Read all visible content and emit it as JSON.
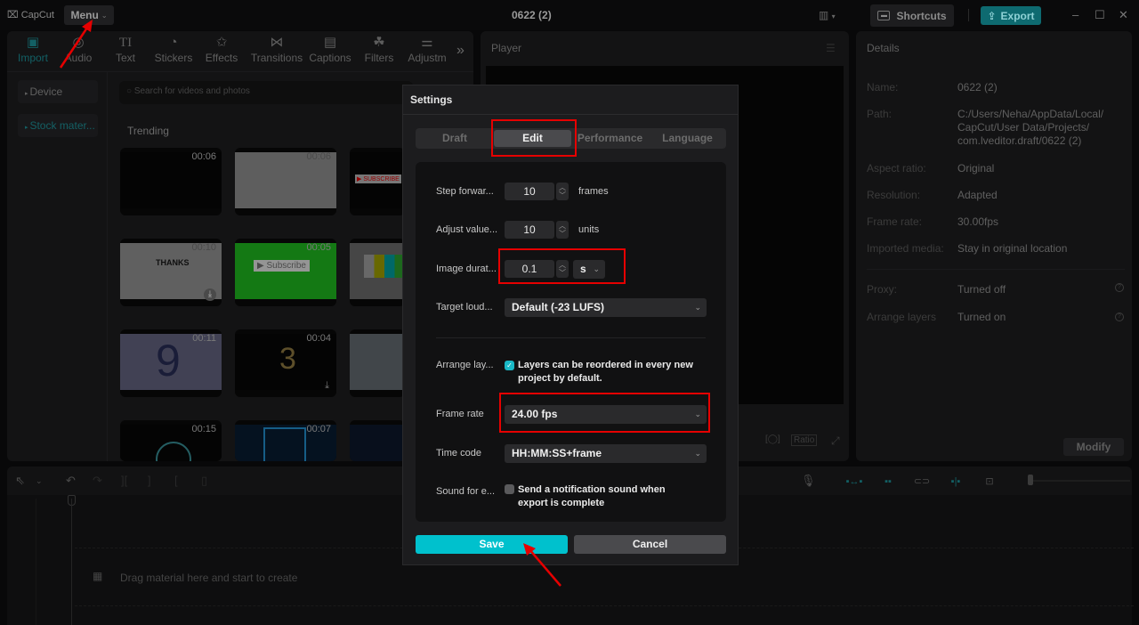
{
  "titlebar": {
    "app_name": "CapCut",
    "menu_label": "Menu",
    "project_title": "0622 (2)",
    "shortcuts_label": "Shortcuts",
    "export_label": "Export"
  },
  "toolbar": {
    "tabs": [
      {
        "label": "Import",
        "icon": "import-icon",
        "glyph": "▣",
        "active": true
      },
      {
        "label": "Audio",
        "icon": "audio-icon",
        "glyph": "◎",
        "active": false
      },
      {
        "label": "Text",
        "icon": "text-icon",
        "glyph": "TI",
        "active": false
      },
      {
        "label": "Stickers",
        "icon": "stickers-icon",
        "glyph": "◔",
        "active": false
      },
      {
        "label": "Effects",
        "icon": "effects-icon",
        "glyph": "✩",
        "active": false
      },
      {
        "label": "Transitions",
        "icon": "transitions-icon",
        "glyph": "⋈",
        "active": false
      },
      {
        "label": "Captions",
        "icon": "captions-icon",
        "glyph": "▤",
        "active": false
      },
      {
        "label": "Filters",
        "icon": "filters-icon",
        "glyph": "☘",
        "active": false
      },
      {
        "label": "Adjustm",
        "icon": "adjustment-icon",
        "glyph": "⚌",
        "active": false
      }
    ],
    "more_glyph": "»"
  },
  "media": {
    "nav": [
      {
        "label": "Device",
        "active": false
      },
      {
        "label": "Stock mater...",
        "active": true
      }
    ],
    "search_placeholder": "Search for videos and photos",
    "section_title": "Trending",
    "thumbnails": [
      {
        "duration": "00:06",
        "bg": "#050505"
      },
      {
        "duration": "00:06",
        "bg": "#6b6b6b"
      },
      {
        "duration": "",
        "bg": "#050505"
      },
      {
        "duration": "00:10",
        "bg": "#6e6e6e"
      },
      {
        "duration": "00:05",
        "bg": "#178a17"
      },
      {
        "duration": "",
        "bg": "#505050"
      },
      {
        "duration": "00:11",
        "bg": "#4a4b60"
      },
      {
        "duration": "00:04",
        "bg": "#050505"
      },
      {
        "duration": "",
        "bg": "#4b5055"
      },
      {
        "duration": "00:15",
        "bg": "#050505"
      },
      {
        "duration": "00:07",
        "bg": "#061525"
      },
      {
        "duration": "",
        "bg": "#0a1220"
      }
    ],
    "thumb_text": {
      "thanks": "THANKS",
      "subscribe": "Subscribe",
      "nine": "9",
      "three": "3"
    }
  },
  "player": {
    "title": "Player",
    "ratio_label": "Ratio"
  },
  "details": {
    "title": "Details",
    "rows": [
      {
        "label": "Name:",
        "value": "0622 (2)"
      },
      {
        "label": "Path:",
        "value": "C:/Users/Neha/AppData/Local/ CapCut/User Data/Projects/ com.lveditor.draft/0622 (2)"
      },
      {
        "label": "Aspect ratio:",
        "value": "Original"
      },
      {
        "label": "Resolution:",
        "value": "Adapted"
      },
      {
        "label": "Frame rate:",
        "value": "30.00fps"
      },
      {
        "label": "Imported media:",
        "value": "Stay in original location"
      },
      {
        "label": "Proxy:",
        "value": "Turned off"
      },
      {
        "label": "Arrange layers",
        "value": "Turned on"
      }
    ],
    "modify_label": "Modify"
  },
  "timeline": {
    "drop_hint": "Drag material here and start to create"
  },
  "settings": {
    "title": "Settings",
    "tabs": [
      {
        "label": "Draft",
        "active": false
      },
      {
        "label": "Edit",
        "active": true
      },
      {
        "label": "Performance",
        "active": false
      },
      {
        "label": "Language",
        "active": false
      }
    ],
    "step_forward": {
      "label": "Step forwar...",
      "value": "10",
      "unit": "frames"
    },
    "adjust_value": {
      "label": "Adjust value...",
      "value": "10",
      "unit": "units"
    },
    "image_duration": {
      "label": "Image durat...",
      "value": "0.1",
      "unit_selected": "s"
    },
    "target_loudness": {
      "label": "Target loud...",
      "selected": "Default (-23 LUFS)"
    },
    "arrange_layers": {
      "label": "Arrange lay...",
      "checked": true,
      "text": "Layers can be reordered in every new project by default."
    },
    "frame_rate": {
      "label": "Frame rate",
      "selected": "24.00 fps"
    },
    "time_code": {
      "label": "Time code",
      "selected": "HH:MM:SS+frame"
    },
    "sound_export": {
      "label": "Sound for e...",
      "checked": false,
      "text": "Send a notification sound when export is complete"
    },
    "save_label": "Save",
    "cancel_label": "Cancel"
  },
  "colors": {
    "accent": "#00c1cd",
    "highlight": "#e60000",
    "export": "#0e6a70"
  }
}
